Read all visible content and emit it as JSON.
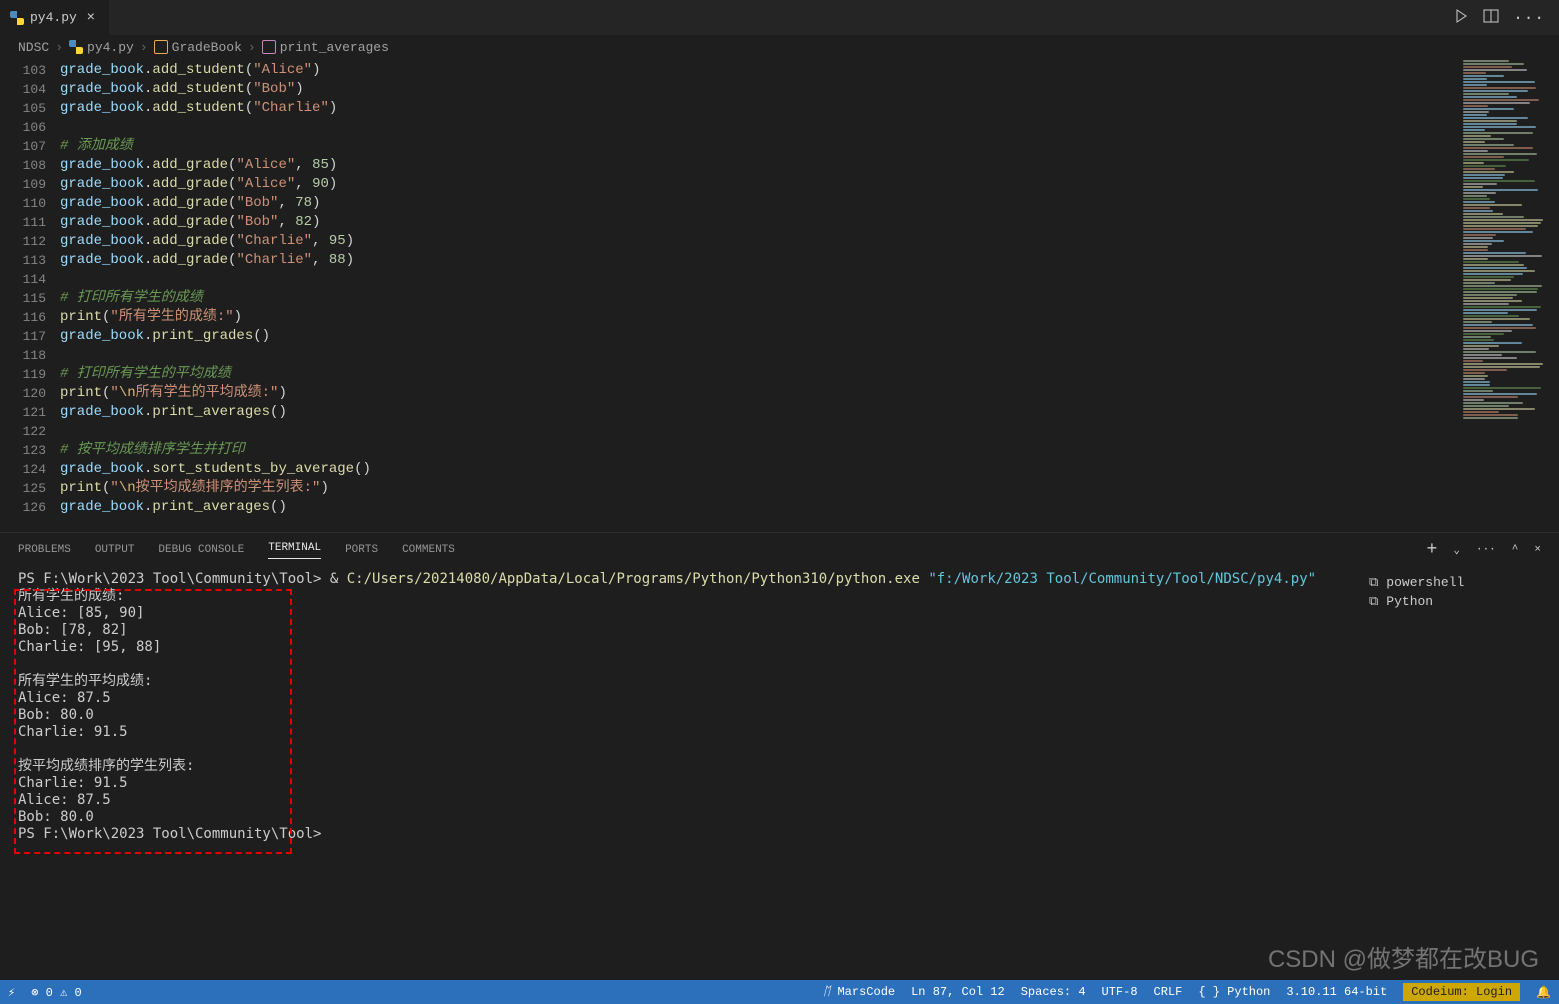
{
  "tab": {
    "filename": "py4.py"
  },
  "breadcrumb": {
    "root": "NDSC",
    "file": "py4.py",
    "class": "GradeBook",
    "method": "print_averages"
  },
  "code_lines": [
    {
      "n": 103,
      "t": "call",
      "obj": "grade_book",
      "m": "add_student",
      "args": "\"Alice\"",
      "after": ")"
    },
    {
      "n": 104,
      "t": "call",
      "obj": "grade_book",
      "m": "add_student",
      "args": "\"Bob\"",
      "after": ")"
    },
    {
      "n": 105,
      "t": "call",
      "obj": "grade_book",
      "m": "add_student",
      "args": "\"Charlie\"",
      "after": ")"
    },
    {
      "n": 106,
      "t": "blank"
    },
    {
      "n": 107,
      "t": "cmt",
      "txt": "# 添加成绩"
    },
    {
      "n": 108,
      "t": "call2",
      "obj": "grade_book",
      "m": "add_grade",
      "a1": "\"Alice\"",
      "a2": "85"
    },
    {
      "n": 109,
      "t": "call2",
      "obj": "grade_book",
      "m": "add_grade",
      "a1": "\"Alice\"",
      "a2": "90"
    },
    {
      "n": 110,
      "t": "call2",
      "obj": "grade_book",
      "m": "add_grade",
      "a1": "\"Bob\"",
      "a2": "78"
    },
    {
      "n": 111,
      "t": "call2",
      "obj": "grade_book",
      "m": "add_grade",
      "a1": "\"Bob\"",
      "a2": "82"
    },
    {
      "n": 112,
      "t": "call2",
      "obj": "grade_book",
      "m": "add_grade",
      "a1": "\"Charlie\"",
      "a2": "95"
    },
    {
      "n": 113,
      "t": "call2",
      "obj": "grade_book",
      "m": "add_grade",
      "a1": "\"Charlie\"",
      "a2": "88"
    },
    {
      "n": 114,
      "t": "blank"
    },
    {
      "n": 115,
      "t": "cmt",
      "txt": "# 打印所有学生的成绩"
    },
    {
      "n": 116,
      "t": "print",
      "s": "\"所有学生的成绩:\""
    },
    {
      "n": 117,
      "t": "call0",
      "obj": "grade_book",
      "m": "print_grades"
    },
    {
      "n": 118,
      "t": "blank"
    },
    {
      "n": 119,
      "t": "cmt",
      "txt": "# 打印所有学生的平均成绩"
    },
    {
      "n": 120,
      "t": "printn",
      "s1": "\"",
      "esc": "\\n",
      "s2": "所有学生的平均成绩:\""
    },
    {
      "n": 121,
      "t": "call0",
      "obj": "grade_book",
      "m": "print_averages"
    },
    {
      "n": 122,
      "t": "blank"
    },
    {
      "n": 123,
      "t": "cmt",
      "txt": "# 按平均成绩排序学生并打印"
    },
    {
      "n": 124,
      "t": "call0",
      "obj": "grade_book",
      "m": "sort_students_by_average"
    },
    {
      "n": 125,
      "t": "printn",
      "s1": "\"",
      "esc": "\\n",
      "s2": "按平均成绩排序的学生列表:\""
    },
    {
      "n": 126,
      "t": "call0",
      "obj": "grade_book",
      "m": "print_averages"
    }
  ],
  "panel_tabs": {
    "problems": "PROBLEMS",
    "output": "OUTPUT",
    "debug": "DEBUG CONSOLE",
    "terminal": "TERMINAL",
    "ports": "PORTS",
    "comments": "COMMENTS"
  },
  "terminal": {
    "prompt1_pre": "PS F:\\Work\\2023 Tool\\Community\\Tool> & ",
    "cmd_path": "C:/Users/20214080/AppData/Local/Programs/Python/Python310/python.exe ",
    "cmd_arg": "\"f:/Work/2023 Tool/Community/Tool/NDSC/py4.py\"",
    "lines": [
      "所有学生的成绩:",
      "Alice: [85, 90]",
      "Bob: [78, 82]",
      "Charlie: [95, 88]",
      "",
      "所有学生的平均成绩:",
      "Alice: 87.5",
      "Bob: 80.0",
      "Charlie: 91.5",
      "",
      "按平均成绩排序的学生列表:",
      "Charlie: 91.5",
      "Alice: 87.5",
      "Bob: 80.0"
    ],
    "prompt2": "PS F:\\Work\\2023 Tool\\Community\\Tool> "
  },
  "term_side": {
    "powershell": "powershell",
    "python": "Python"
  },
  "status": {
    "marscode": "MarsCode",
    "lncol": "Ln 87, Col 12",
    "spaces": "Spaces: 4",
    "enc": "UTF-8",
    "eol": "CRLF",
    "lang": "Python",
    "ver": "3.10.11 64-bit",
    "codeium": "Codeium: Login"
  },
  "watermark": "CSDN @做梦都在改BUG"
}
